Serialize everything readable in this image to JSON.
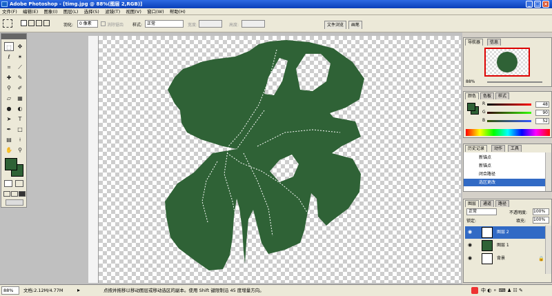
{
  "window": {
    "title": "Adobe Photoshop - [timg.jpg @ 88%(图层 2,RGB)]"
  },
  "menu": [
    "文件(F)",
    "编辑(E)",
    "图象(I)",
    "图层(L)",
    "选择(S)",
    "滤镜(T)",
    "视图(V)",
    "窗口(W)",
    "帮助(H)"
  ],
  "options": {
    "feather_label": "羽化:",
    "feather_value": "0 像素",
    "antialias_label": "消除锯齿",
    "style_label": "样式:",
    "style_value": "正常",
    "width_label": "宽度:",
    "height_label": "高度:",
    "tab_file_browser": "文件浏览",
    "tab_brushes": "画笔"
  },
  "navigator": {
    "tabs": [
      "导航器",
      "信息"
    ],
    "zoom": "88%"
  },
  "color": {
    "tabs": [
      "颜色",
      "色板",
      "样式"
    ],
    "r_label": "R",
    "g_label": "G",
    "b_label": "B",
    "r": "48",
    "g": "90",
    "b": "52",
    "fg_color": "#30 5a34"
  },
  "history": {
    "tabs": [
      "历史记录",
      "动作",
      "工具"
    ],
    "items": [
      "新锚点",
      "新锚点",
      "闭合路径",
      "选区更改"
    ]
  },
  "layers": {
    "tabs": [
      "图层",
      "通道",
      "路径"
    ],
    "blend_mode": "正常",
    "opacity_label": "不透明度:",
    "opacity": "100%",
    "lock_label": "锁定:",
    "fill_label": "填充:",
    "fill": "100%",
    "items": [
      "图层 2",
      "图层 1",
      "背景"
    ]
  },
  "status": {
    "zoom": "88%",
    "doc_size": "文档:2.12M/4.77M",
    "hint": "点按并拖移以移动图层或移动选区的副本。使用 Shift 键限制沿 45 度增量方向。"
  },
  "colors": {
    "leaf": "#2f6236",
    "title_bar": "#0a3fb8",
    "selection": "#316ac5"
  }
}
